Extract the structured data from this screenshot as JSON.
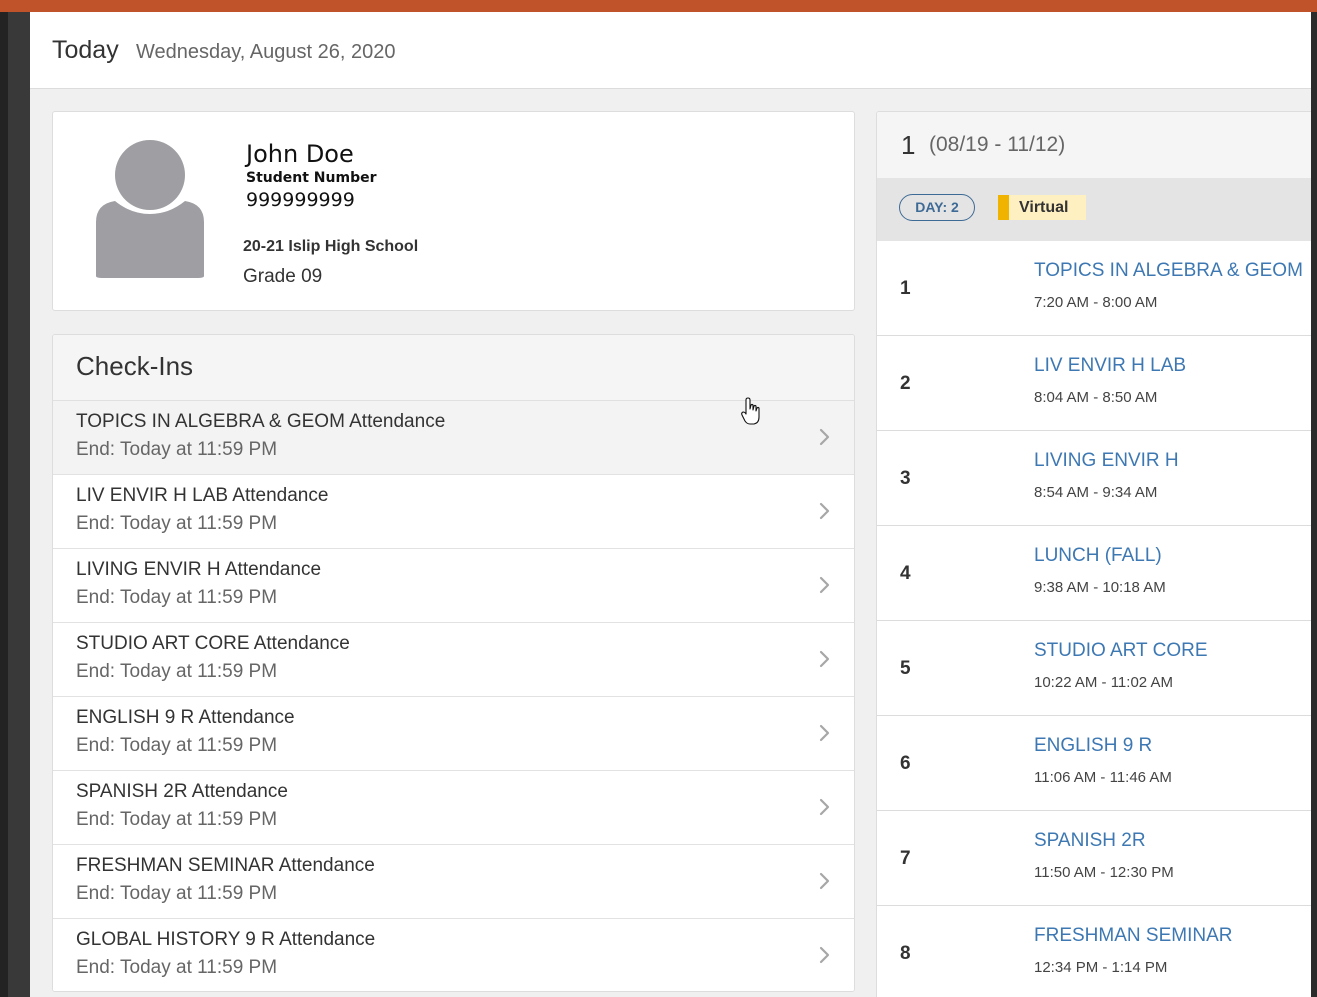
{
  "header": {
    "title": "Today",
    "date": "Wednesday, August 26, 2020"
  },
  "student": {
    "name": "John Doe",
    "number_label": "Student Number",
    "number": "999999999",
    "school": "20-21 Islip High School",
    "grade": "Grade 09"
  },
  "checkins": {
    "title": "Check-Ins",
    "items": [
      {
        "name": "TOPICS IN ALGEBRA & GEOM Attendance",
        "end": "End: Today at 11:59 PM"
      },
      {
        "name": "LIV ENVIR H LAB Attendance",
        "end": "End: Today at 11:59 PM"
      },
      {
        "name": "LIVING ENVIR H Attendance",
        "end": "End: Today at 11:59 PM"
      },
      {
        "name": "STUDIO ART CORE Attendance",
        "end": "End: Today at 11:59 PM"
      },
      {
        "name": "ENGLISH 9 R Attendance",
        "end": "End: Today at 11:59 PM"
      },
      {
        "name": "SPANISH 2R Attendance",
        "end": "End: Today at 11:59 PM"
      },
      {
        "name": "FRESHMAN SEMINAR Attendance",
        "end": "End: Today at 11:59 PM"
      },
      {
        "name": "GLOBAL HISTORY 9 R Attendance",
        "end": "End: Today at 11:59 PM"
      }
    ]
  },
  "schedule": {
    "term_number": "1",
    "term_dates": "(08/19 - 11/12)",
    "day_badge": "DAY: 2",
    "mode": "Virtual",
    "periods": [
      {
        "period": "1",
        "course": "TOPICS IN ALGEBRA & GEOM",
        "time": "7:20 AM - 8:00 AM"
      },
      {
        "period": "2",
        "course": "LIV ENVIR H LAB",
        "time": "8:04 AM - 8:50 AM"
      },
      {
        "period": "3",
        "course": "LIVING ENVIR H",
        "time": "8:54 AM - 9:34 AM"
      },
      {
        "period": "4",
        "course": "LUNCH (FALL)",
        "time": "9:38 AM - 10:18 AM"
      },
      {
        "period": "5",
        "course": "STUDIO ART CORE",
        "time": "10:22 AM - 11:02 AM"
      },
      {
        "period": "6",
        "course": "ENGLISH 9 R",
        "time": "11:06 AM - 11:46 AM"
      },
      {
        "period": "7",
        "course": "SPANISH 2R",
        "time": "11:50 AM - 12:30 PM"
      },
      {
        "period": "8",
        "course": "FRESHMAN SEMINAR",
        "time": "12:34 PM - 1:14 PM"
      }
    ]
  },
  "colors": {
    "accent_top": "#c1532a",
    "link_blue": "#3d78b3",
    "badge_blue": "#3e6a96",
    "virtual_yellow": "#f0b400"
  },
  "icons": {
    "avatar": "user-silhouette-icon",
    "chevron": "chevron-right-icon",
    "cursor": "hand-pointer-icon"
  }
}
